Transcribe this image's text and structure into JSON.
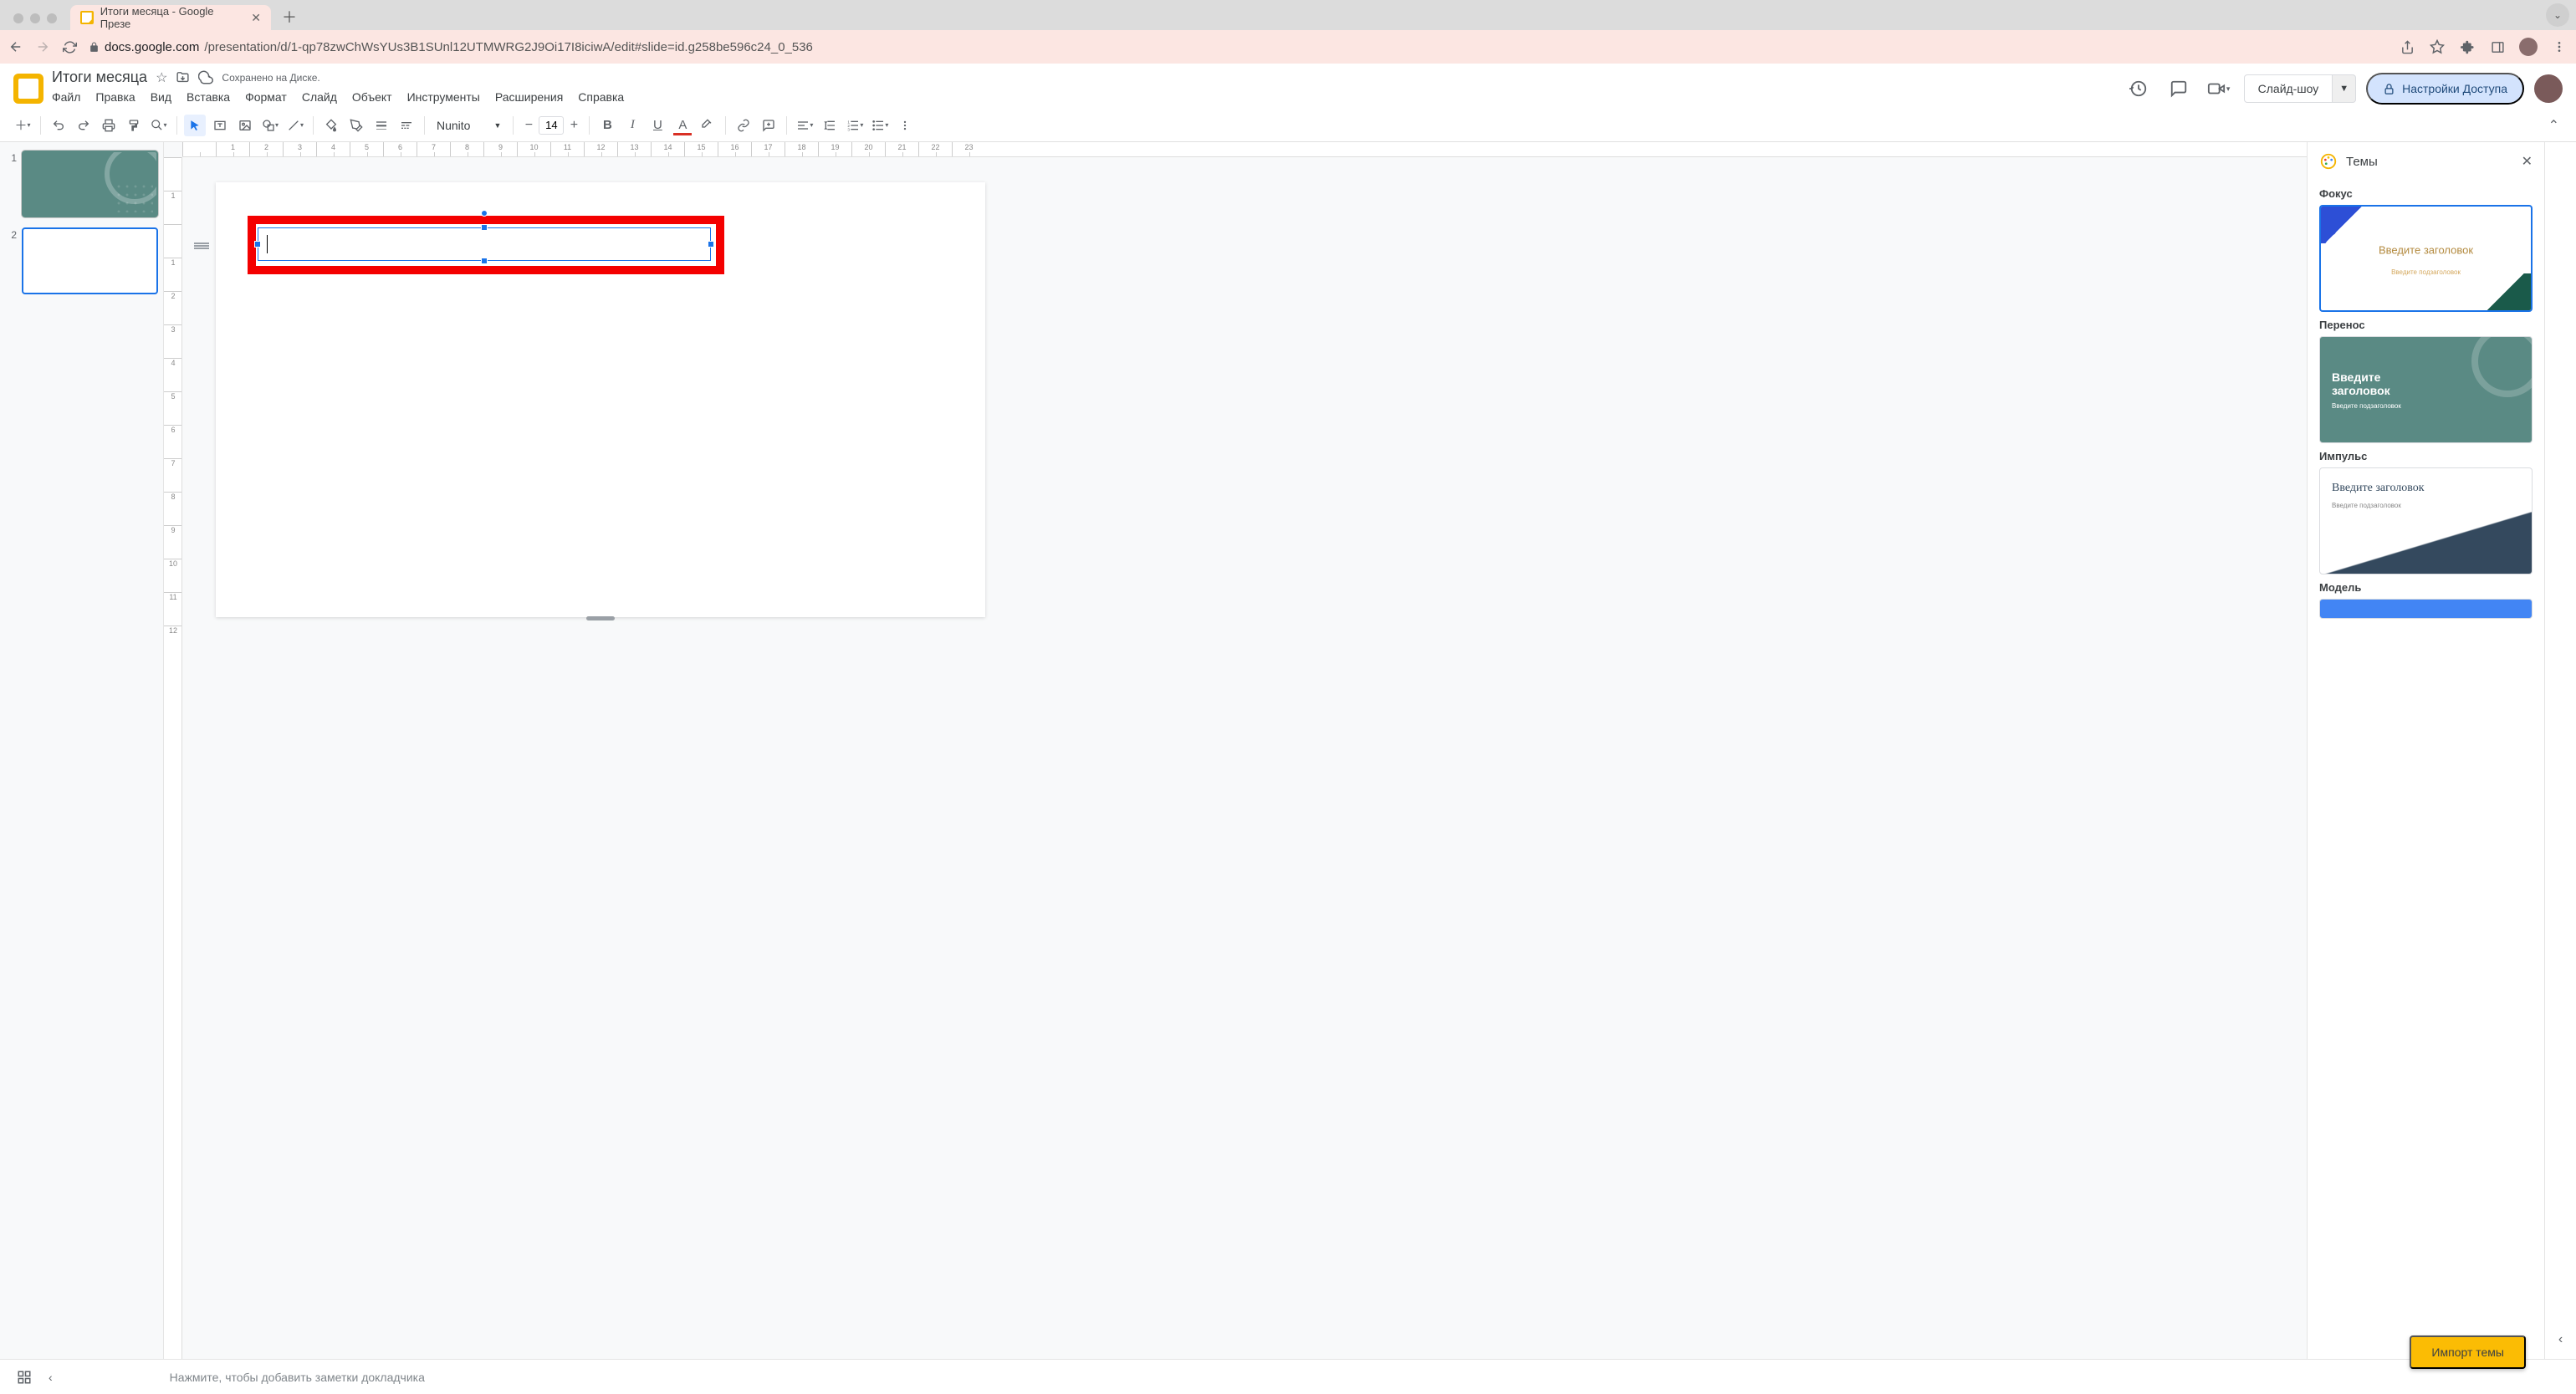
{
  "browser": {
    "tab_title": "Итоги месяца - Google Презе",
    "url_host": "docs.google.com",
    "url_path": "/presentation/d/1-qp78zwChWsYUs3B1SUnl12UTMWRG2J9Oi17I8iciwA/edit#slide=id.g258be596c24_0_536"
  },
  "doc": {
    "title": "Итоги месяца",
    "save_status": "Сохранено на Диске."
  },
  "menus": [
    "Файл",
    "Правка",
    "Вид",
    "Вставка",
    "Формат",
    "Слайд",
    "Объект",
    "Инструменты",
    "Расширения",
    "Справка"
  ],
  "header_buttons": {
    "slideshow": "Слайд-шоу",
    "share": "Настройки Доступа"
  },
  "toolbar": {
    "font_name": "Nunito",
    "font_size": "14"
  },
  "thumbnails": [
    {
      "num": "1",
      "variant": "teal",
      "selected": false
    },
    {
      "num": "2",
      "variant": "blank",
      "selected": true
    }
  ],
  "ruler_h": [
    "",
    "1",
    "2",
    "3",
    "4",
    "5",
    "6",
    "7",
    "8",
    "9",
    "10",
    "11",
    "12",
    "13",
    "14",
    "15",
    "16",
    "17",
    "18",
    "19",
    "20",
    "21",
    "22",
    "23"
  ],
  "ruler_v": [
    "",
    "1",
    "",
    "1",
    "2",
    "3",
    "4",
    "5",
    "6",
    "7",
    "8",
    "9",
    "10",
    "11",
    "12"
  ],
  "themes_panel": {
    "title": "Темы",
    "import": "Импорт темы",
    "items": [
      {
        "label": "Фокус",
        "variant": "focus",
        "title": "Введите заголовок",
        "sub": "Введите подзаголовок",
        "selected": true
      },
      {
        "label": "Перенос",
        "variant": "teal",
        "title": "Введите заголовок",
        "sub": "Введите подзаголовок"
      },
      {
        "label": "Импульс",
        "variant": "impulse",
        "title": "Введите заголовок",
        "sub": "Введите подзаголовок"
      },
      {
        "label": "Модель",
        "variant": "model"
      }
    ]
  },
  "notes_placeholder": "Нажмите, чтобы добавить заметки докладчика"
}
